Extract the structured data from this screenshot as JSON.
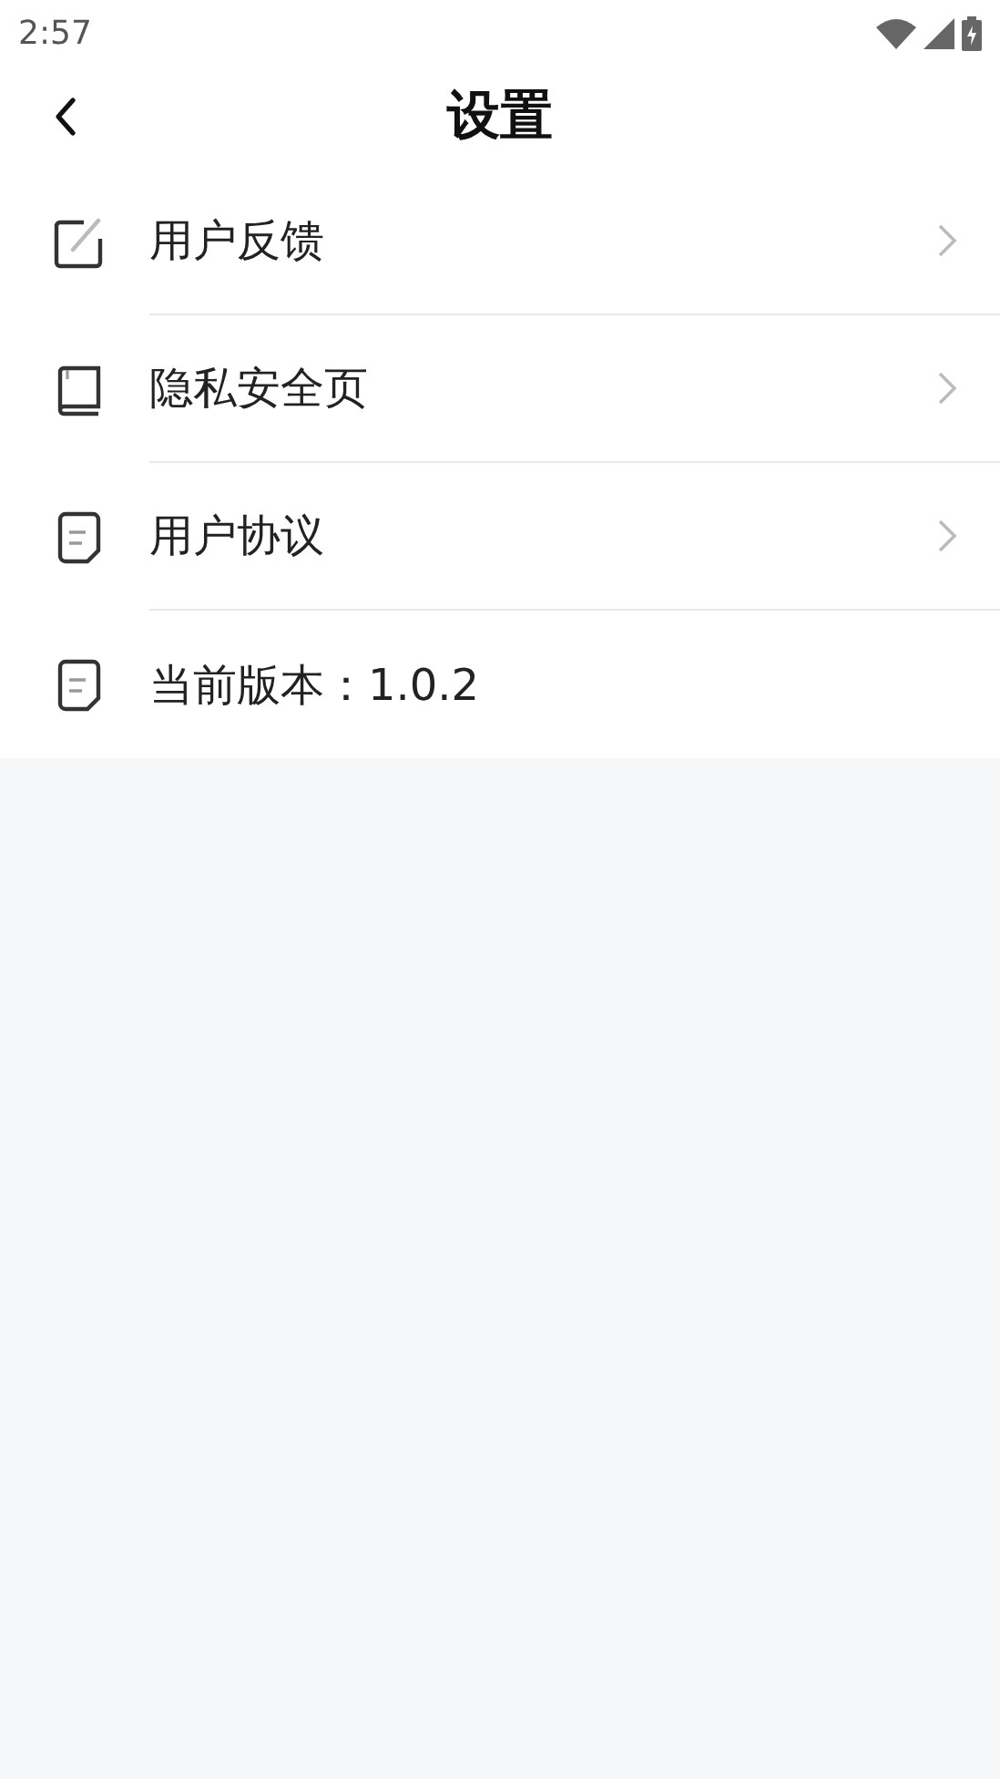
{
  "status_bar": {
    "time": "2:57"
  },
  "header": {
    "title": "设置"
  },
  "items": [
    {
      "kind": "edit",
      "label": "用户反馈",
      "chevron": true
    },
    {
      "kind": "book",
      "label": "隐私安全页",
      "chevron": true
    },
    {
      "kind": "doc",
      "label": "用户协议",
      "chevron": true
    },
    {
      "kind": "doc",
      "label": "当前版本：1.0.2",
      "chevron": false
    }
  ]
}
